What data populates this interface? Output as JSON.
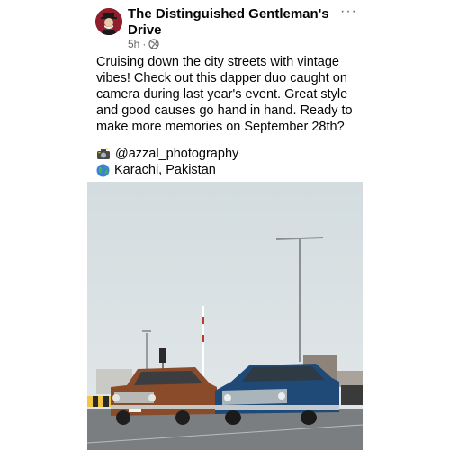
{
  "post": {
    "author": "The Distinguished Gentleman's Drive",
    "time": "5h",
    "separator": "·",
    "more_label": "···",
    "text": "Cruising down the city streets with vintage vibes! Check out this dapper duo caught on camera during last year's event. Great style and good causes go hand in hand. Ready to make more memories on September 28th?",
    "photo_credit": "@azzal_photography",
    "location": "Karachi, Pakistan"
  },
  "icons": {
    "avatar": "gentleman-logo",
    "privacy": "globe-icon",
    "camera": "camera-flash-emoji",
    "location": "globe-emoji"
  },
  "colors": {
    "secondary_text": "#65676b",
    "sky": "#d5dde0",
    "brown_car": "#8a4b2a",
    "blue_car": "#1f4a78"
  }
}
